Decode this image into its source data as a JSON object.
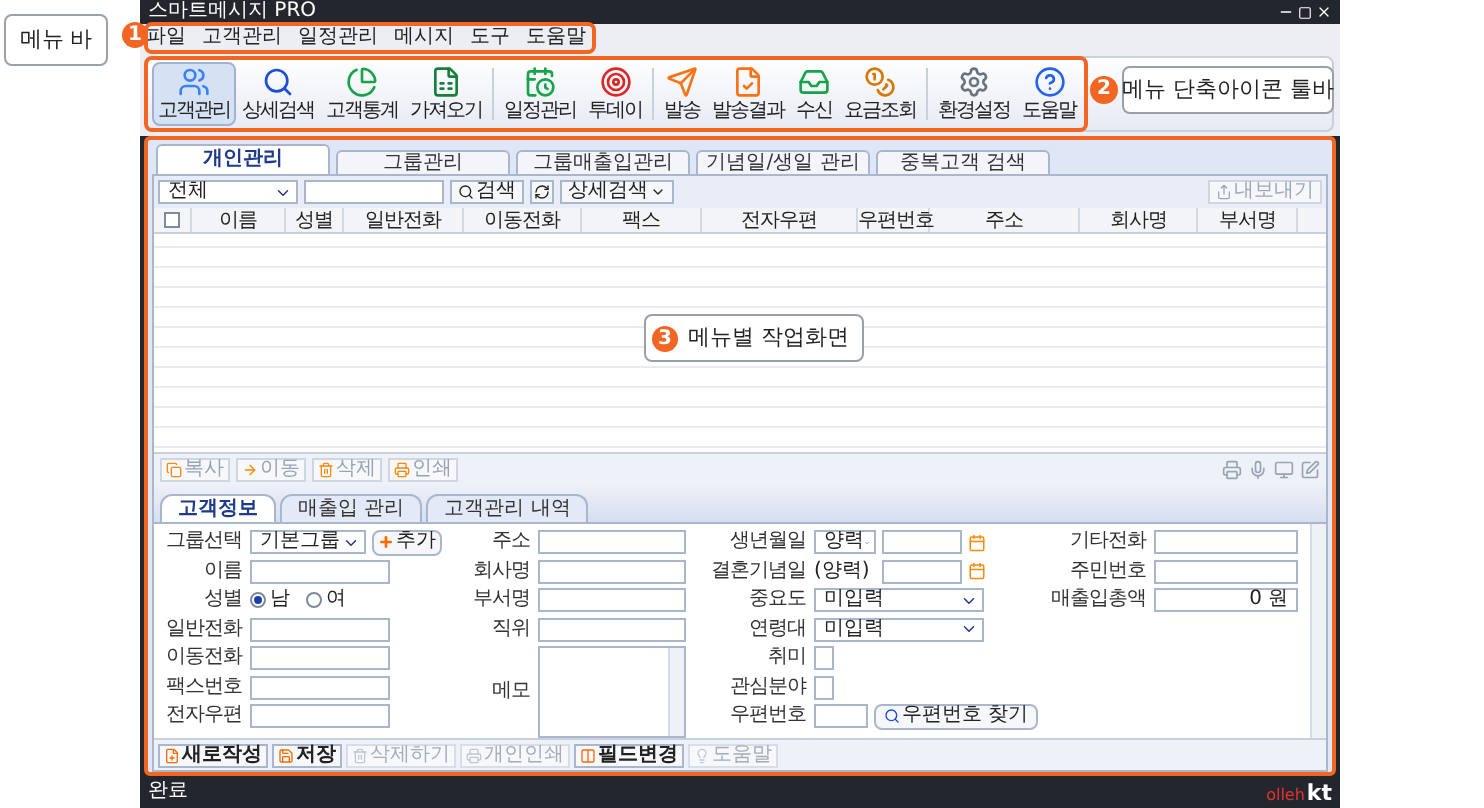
{
  "window": {
    "title": "스마트메시지 PRO"
  },
  "callouts": [
    {
      "number": "1",
      "label": "메뉴 바"
    },
    {
      "number": "2",
      "label": "메뉴 단축아이콘 툴바"
    },
    {
      "number": "3",
      "label": "메뉴별 작업화면"
    }
  ],
  "menu_bar": [
    "파일",
    "고객관리",
    "일정관리",
    "메시지",
    "도구",
    "도움말"
  ],
  "toolbar": {
    "groups": [
      [
        {
          "label": "고객관리",
          "selected": true
        },
        {
          "label": "상세검색",
          "selected": false
        },
        {
          "label": "고객통계",
          "selected": false
        },
        {
          "label": "가져오기",
          "selected": false
        }
      ],
      [
        {
          "label": "일정관리",
          "selected": false
        },
        {
          "label": "투데이",
          "selected": false
        }
      ],
      [
        {
          "label": "발송",
          "selected": false
        },
        {
          "label": "발송결과",
          "selected": false
        },
        {
          "label": "수신",
          "selected": false
        },
        {
          "label": "요금조회",
          "selected": false
        }
      ],
      [
        {
          "label": "환경설정",
          "selected": false
        },
        {
          "label": "도움말",
          "selected": false
        }
      ]
    ]
  },
  "main_tabs": [
    {
      "label": "개인관리",
      "selected": true
    },
    {
      "label": "그룹관리",
      "selected": false
    },
    {
      "label": "그룹매출입관리",
      "selected": false
    },
    {
      "label": "기념일/생일 관리",
      "selected": false
    },
    {
      "label": "중복고객 검색",
      "selected": false
    }
  ],
  "search": {
    "filter": "전체",
    "search_button": "검색",
    "detail_button": "상세검색",
    "export_button": {
      "label": "내보내기",
      "disabled": true
    }
  },
  "table": {
    "select_all_checked": false,
    "columns": [
      "이름",
      "성별",
      "일반전화",
      "이동전화",
      "팩스",
      "전자우편",
      "우편번호",
      "주소",
      "회사명",
      "부서명"
    ]
  },
  "actions": [
    {
      "label": "복사",
      "disabled": true
    },
    {
      "label": "이동",
      "disabled": true
    },
    {
      "label": "삭제",
      "disabled": true
    },
    {
      "label": "인쇄",
      "disabled": true
    }
  ],
  "sub_tabs": [
    {
      "label": "고객정보",
      "selected": true
    },
    {
      "label": "매출입 관리",
      "selected": false
    },
    {
      "label": "고객관리 내역",
      "selected": false
    }
  ],
  "form_columns": [
    [
      {
        "kind": "group",
        "label": "그룹선택",
        "value": "기본그룹",
        "button": "추가"
      },
      {
        "kind": "text",
        "label": "이름"
      },
      {
        "kind": "radio",
        "label": "성별",
        "options": [
          {
            "label": "남",
            "selected": true
          },
          {
            "label": "여",
            "selected": false
          }
        ]
      },
      {
        "kind": "text",
        "label": "일반전화"
      },
      {
        "kind": "text",
        "label": "이동전화"
      },
      {
        "kind": "text",
        "label": "팩스번호"
      },
      {
        "kind": "text",
        "label": "전자우편"
      }
    ],
    [
      {
        "kind": "text",
        "label": "주소"
      },
      {
        "kind": "text",
        "label": "회사명"
      },
      {
        "kind": "text",
        "label": "부서명"
      },
      {
        "kind": "text",
        "label": "직위"
      },
      {
        "kind": "memo",
        "label": "메모"
      }
    ],
    [
      {
        "kind": "date",
        "label": "생년월일",
        "value": "양력"
      },
      {
        "kind": "date_fixed",
        "label": "결혼기념일",
        "value": "(양력)"
      },
      {
        "kind": "select",
        "label": "중요도",
        "value": "미입력"
      },
      {
        "kind": "select",
        "label": "연령대",
        "value": "미입력"
      },
      {
        "kind": "text",
        "label": "취미"
      },
      {
        "kind": "text",
        "label": "관심분야"
      },
      {
        "kind": "zip",
        "label": "우편번호",
        "button": "우편번호 찾기"
      }
    ],
    [
      {
        "kind": "text",
        "label": "기타전화"
      },
      {
        "kind": "text",
        "label": "주민번호"
      },
      {
        "kind": "amount",
        "label": "매출입총액",
        "value": "0 원"
      }
    ]
  ],
  "bottom_buttons": [
    {
      "label": "새로작성",
      "disabled": false
    },
    {
      "label": "저장",
      "disabled": false
    },
    {
      "label": "삭제하기",
      "disabled": true
    },
    {
      "label": "개인인쇄",
      "disabled": true
    },
    {
      "label": "필드변경",
      "disabled": false
    },
    {
      "label": "도움말",
      "disabled": true
    }
  ],
  "status_bar": {
    "text": "완료",
    "logo_left": "olleh",
    "logo_right": "kt"
  }
}
